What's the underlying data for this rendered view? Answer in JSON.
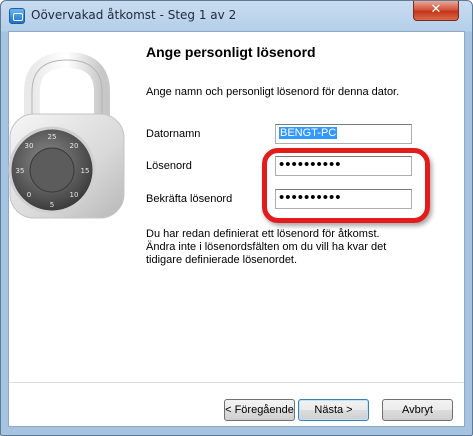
{
  "window": {
    "title": "Oövervakad åtkomst - Steg 1 av 2",
    "close_label": "✕"
  },
  "page": {
    "heading": "Ange personligt lösenord",
    "description": "Ange namn och personligt lösenord för denna dator."
  },
  "form": {
    "computer_name_label": "Datornamn",
    "computer_name_value": "BENGT-PC",
    "password_label": "Lösenord",
    "password_value": "••••••••••",
    "confirm_label": "Bekräfta lösenord",
    "confirm_value": "••••••••••"
  },
  "note": {
    "line1": "Du har redan definierat ett lösenord för åtkomst.",
    "line2": "Ändra inte i lösenordsfälten om du vill ha kvar det",
    "line3": "tidigare definierade lösenordet."
  },
  "buttons": {
    "back": "< Föregående",
    "next": "Nästa >",
    "cancel": "Avbryt"
  },
  "colors": {
    "highlight": "#e41b1b",
    "selection": "#3399ff"
  },
  "dial_numbers": [
    "25",
    "20",
    "15",
    "10",
    "5",
    "0",
    "35",
    "30"
  ]
}
